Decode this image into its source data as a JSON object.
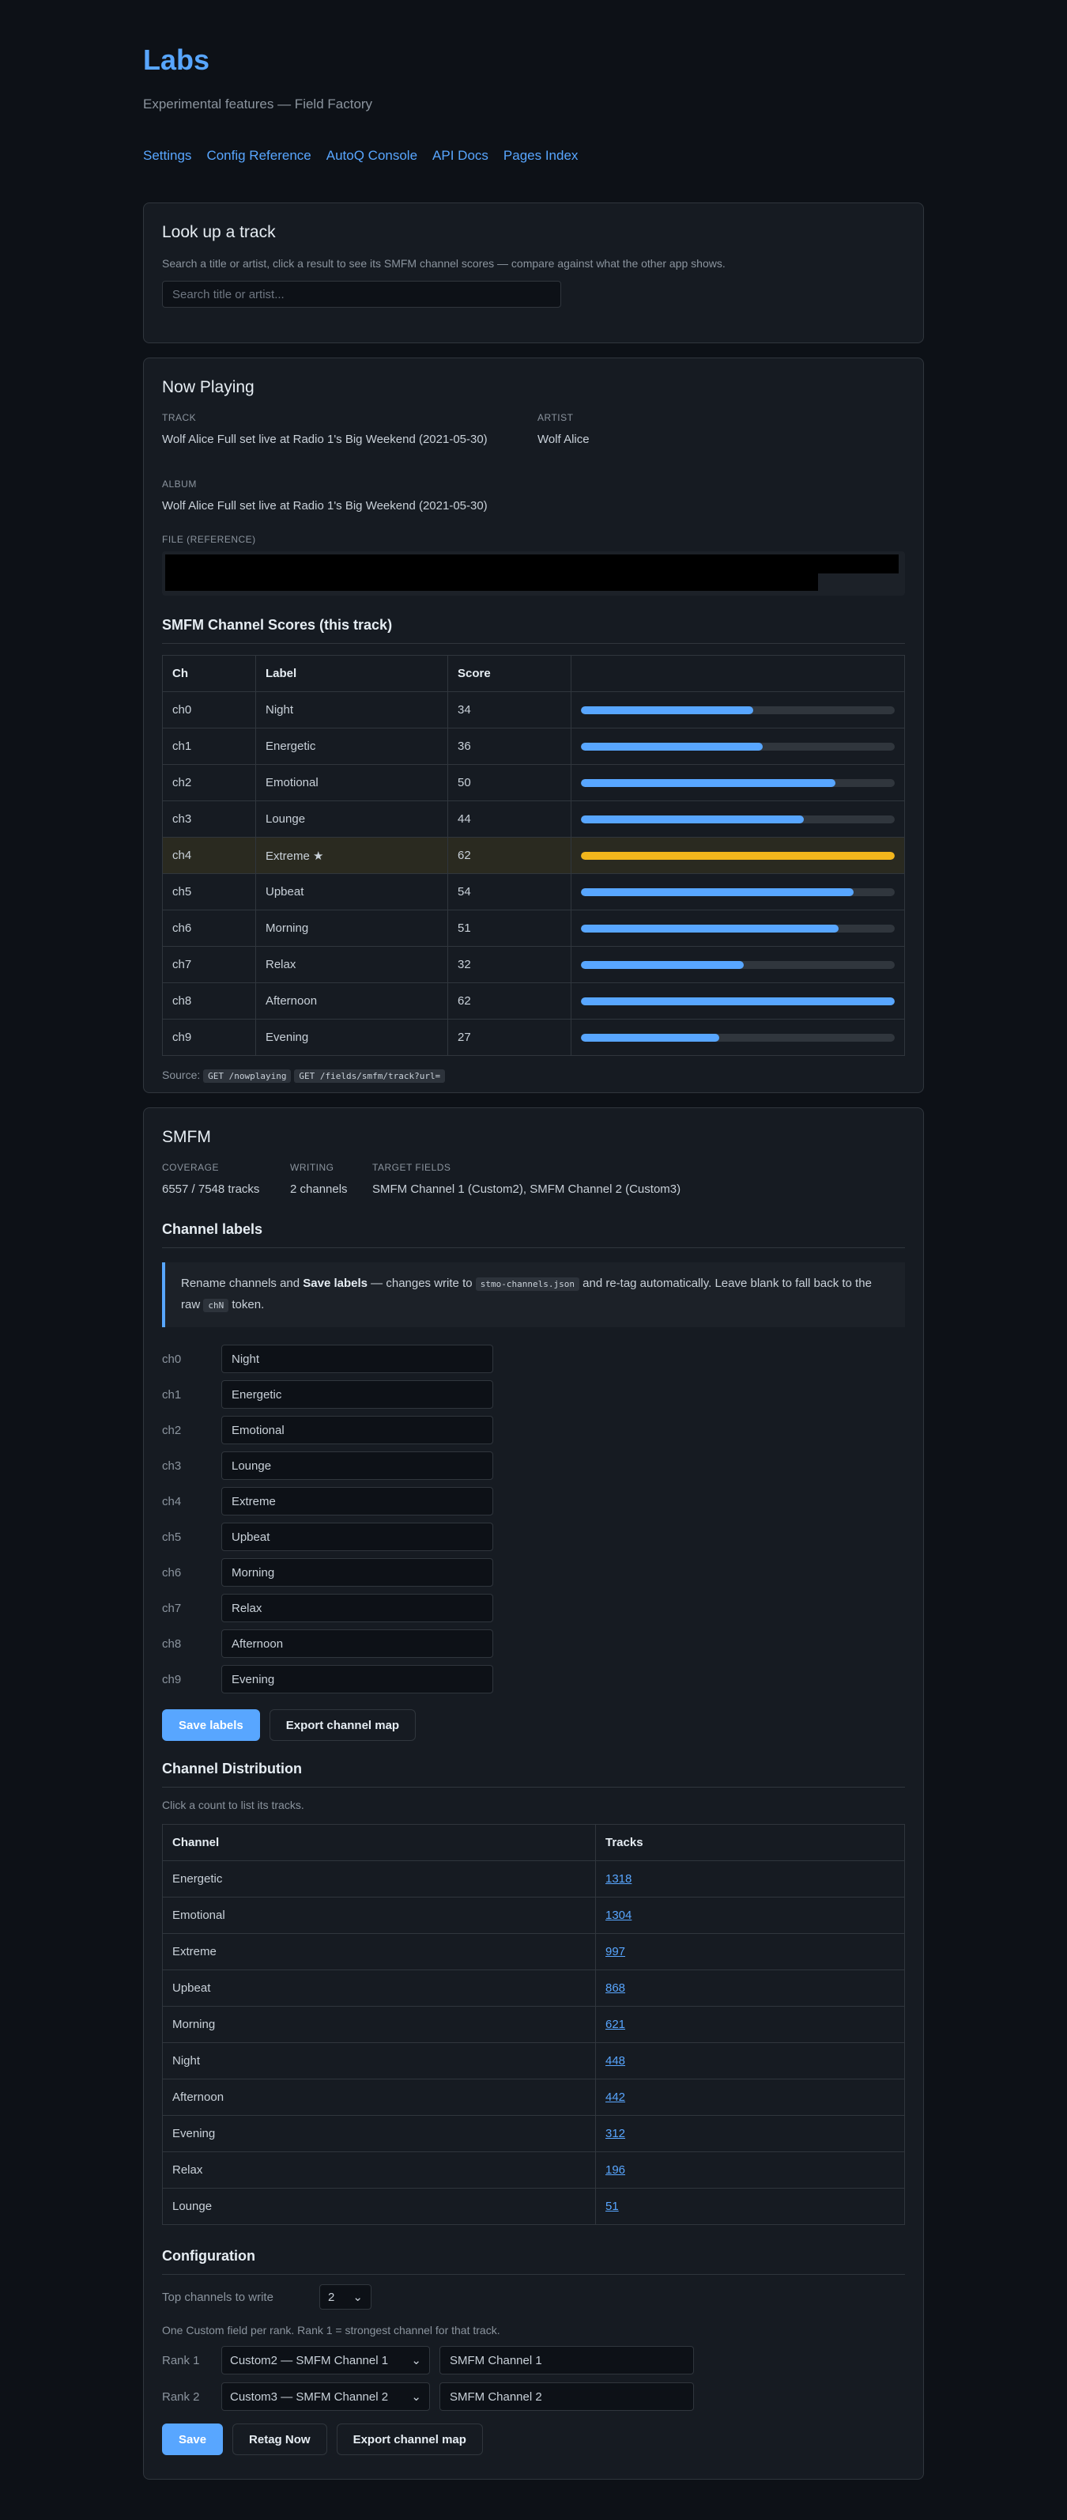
{
  "header": {
    "title": "Labs",
    "subtitle": "Experimental features — Field Factory",
    "nav": [
      "Settings",
      "Config Reference",
      "AutoQ Console",
      "API Docs",
      "Pages Index"
    ]
  },
  "lookup": {
    "title": "Look up a track",
    "description": "Search a title or artist, click a result to see its SMFM channel scores — compare against what the other app shows.",
    "placeholder": "Search title or artist..."
  },
  "now_playing": {
    "title": "Now Playing",
    "track_label": "TRACK",
    "track": "Wolf Alice Full set live at Radio 1's Big Weekend (2021-05-30)",
    "artist_label": "ARTIST",
    "artist": "Wolf Alice",
    "album_label": "ALBUM",
    "album": "Wolf Alice Full set live at Radio 1's Big Weekend (2021-05-30)",
    "file_label": "FILE (REFERENCE)",
    "scores_title": "SMFM Channel Scores (this track)",
    "columns": [
      "Ch",
      "Label",
      "Score",
      ""
    ],
    "rows": [
      {
        "ch": "ch0",
        "label": "Night",
        "score": "34",
        "pct": 0.55
      },
      {
        "ch": "ch1",
        "label": "Energetic",
        "score": "36",
        "pct": 0.58
      },
      {
        "ch": "ch2",
        "label": "Emotional",
        "score": "50",
        "pct": 0.81
      },
      {
        "ch": "ch3",
        "label": "Lounge",
        "score": "44",
        "pct": 0.71
      },
      {
        "ch": "ch4",
        "label": "Extreme ★",
        "score": "62",
        "pct": 1.0,
        "highlight": true
      },
      {
        "ch": "ch5",
        "label": "Upbeat",
        "score": "54",
        "pct": 0.87
      },
      {
        "ch": "ch6",
        "label": "Morning",
        "score": "51",
        "pct": 0.82
      },
      {
        "ch": "ch7",
        "label": "Relax",
        "score": "32",
        "pct": 0.52
      },
      {
        "ch": "ch8",
        "label": "Afternoon",
        "score": "62",
        "pct": 1.0
      },
      {
        "ch": "ch9",
        "label": "Evening",
        "score": "27",
        "pct": 0.44
      }
    ],
    "source_label": "Source:",
    "source_chips": [
      "GET /nowplaying",
      "GET /fields/smfm/track?url="
    ]
  },
  "smfm": {
    "title": "SMFM",
    "coverage_label": "COVERAGE",
    "coverage": "6557 / 7548 tracks",
    "writing_label": "WRITING",
    "writing": "2 channels",
    "target_label": "TARGET FIELDS",
    "target": "SMFM Channel 1 (Custom2), SMFM Channel 2 (Custom3)",
    "labels_title": "Channel labels",
    "note_pre": "Rename channels and ",
    "note_bold": "Save labels",
    "note_mid": " — changes write to ",
    "note_code": "stmo-channels.json",
    "note_post": " and re-tag automatically. Leave blank to fall back to the raw ",
    "note_code2": "chN",
    "note_end": " token.",
    "channels": [
      {
        "ch": "ch0",
        "value": "Night"
      },
      {
        "ch": "ch1",
        "value": "Energetic"
      },
      {
        "ch": "ch2",
        "value": "Emotional"
      },
      {
        "ch": "ch3",
        "value": "Lounge"
      },
      {
        "ch": "ch4",
        "value": "Extreme"
      },
      {
        "ch": "ch5",
        "value": "Upbeat"
      },
      {
        "ch": "ch6",
        "value": "Morning"
      },
      {
        "ch": "ch7",
        "value": "Relax"
      },
      {
        "ch": "ch8",
        "value": "Afternoon"
      },
      {
        "ch": "ch9",
        "value": "Evening"
      }
    ],
    "save_labels": "Save labels",
    "export_map": "Export channel map",
    "dist_title": "Channel Distribution",
    "dist_hint": "Click a count to list its tracks.",
    "dist_columns": [
      "Channel",
      "Tracks"
    ],
    "dist_rows": [
      {
        "channel": "Energetic",
        "tracks": "1318"
      },
      {
        "channel": "Emotional",
        "tracks": "1304"
      },
      {
        "channel": "Extreme",
        "tracks": "997"
      },
      {
        "channel": "Upbeat",
        "tracks": "868"
      },
      {
        "channel": "Morning",
        "tracks": "621"
      },
      {
        "channel": "Night",
        "tracks": "448"
      },
      {
        "channel": "Afternoon",
        "tracks": "442"
      },
      {
        "channel": "Evening",
        "tracks": "312"
      },
      {
        "channel": "Relax",
        "tracks": "196"
      },
      {
        "channel": "Lounge",
        "tracks": "51"
      }
    ],
    "config_title": "Configuration",
    "top_label": "Top channels to write",
    "top_value": "2",
    "rank_hint": "One Custom field per rank. Rank 1 = strongest channel for that track.",
    "ranks": [
      {
        "label": "Rank 1",
        "select": "Custom2 — SMFM Channel 1",
        "value": "SMFM Channel 1"
      },
      {
        "label": "Rank 2",
        "select": "Custom3 — SMFM Channel 2",
        "value": "SMFM Channel 2"
      }
    ],
    "save": "Save",
    "retag": "Retag Now",
    "export_map2": "Export channel map"
  }
}
